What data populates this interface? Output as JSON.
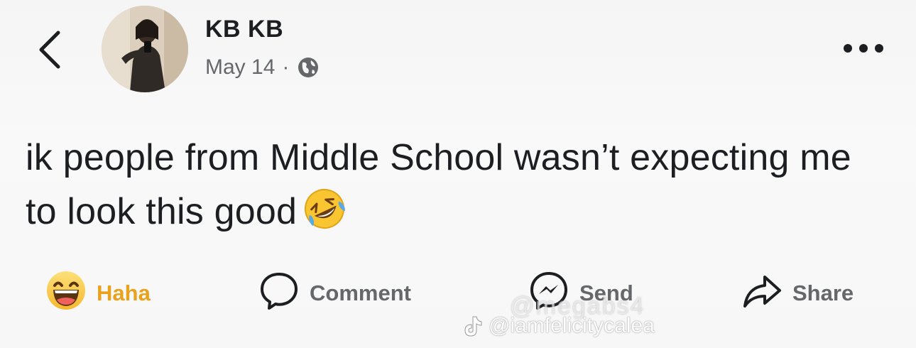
{
  "author": {
    "name": "KB KB",
    "date": "May 14",
    "separator": "·",
    "privacy_icon": "globe-icon"
  },
  "post": {
    "text": "ik people from Middle School wasn’t expecting me to look this good",
    "emoji": "rolling-on-the-floor-laughing"
  },
  "actions": {
    "reaction_label": "Haha",
    "reaction_icon": "haha-emoji-icon",
    "reaction_color": "#e9a21c",
    "comment_label": "Comment",
    "send_label": "Send",
    "share_label": "Share"
  },
  "watermark": {
    "handle_front": "@iamfelicitycalea",
    "handle_back": "@megabs4"
  },
  "colors": {
    "text": "#1c1e21",
    "secondary": "#65676b",
    "background": "#f7f7f7"
  }
}
